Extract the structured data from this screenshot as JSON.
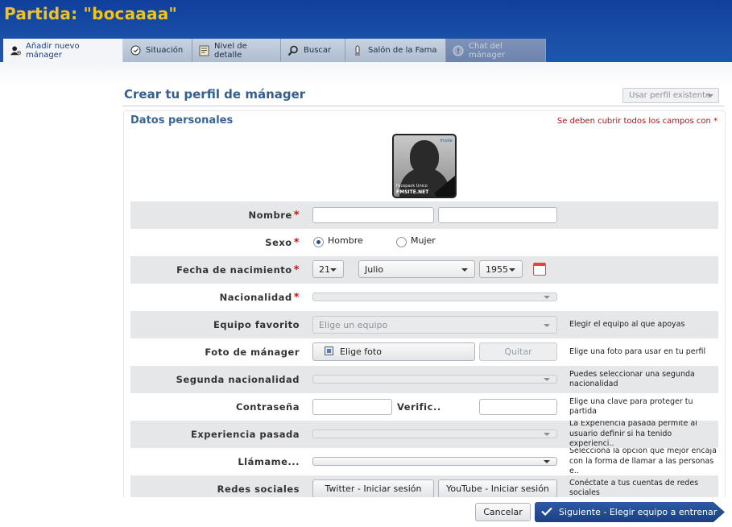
{
  "window": {
    "title": "Partida: \"bocaaaa\""
  },
  "tabs": [
    {
      "label": "Añadir nuevo mánager",
      "icon": "add-manager-icon",
      "active": true
    },
    {
      "label": "Situación",
      "icon": "status-icon"
    },
    {
      "label": "Nivel de detalle",
      "icon": "detail-icon"
    },
    {
      "label": "Buscar",
      "icon": "search-icon"
    },
    {
      "label": "Salón de la Fama",
      "icon": "hall-of-fame-icon"
    },
    {
      "label": "Chat del mánager",
      "icon": "chat-icon",
      "disabled": true
    }
  ],
  "page": {
    "heading": "Crear tu perfil de mánager",
    "existing_profile": "Usar perfil existente"
  },
  "section": {
    "title": "Datos personales",
    "required_note": "Se deben cubrir todos los campos con",
    "required_star": "*"
  },
  "avatar": {
    "caption_small": "Facepack Unico",
    "caption_site": "FMSITE.NET",
    "logo": "fmsite"
  },
  "form": {
    "nombre": {
      "label": "Nombre",
      "first": "",
      "last": ""
    },
    "sexo": {
      "label": "Sexo",
      "opt_male": "Hombre",
      "opt_female": "Mujer",
      "selected": "Hombre"
    },
    "fecha": {
      "label": "Fecha de nacimiento",
      "day": "21",
      "month": "Julio",
      "year": "1955"
    },
    "nacionalidad": {
      "label": "Nacionalidad",
      "value": ""
    },
    "equipo": {
      "label": "Equipo favorito",
      "placeholder": "Elige un equipo",
      "help": "Elegir el equipo al que apoyas"
    },
    "foto": {
      "label": "Foto de mánager",
      "choose": "Elige foto",
      "remove": "Quitar",
      "help": "Elige una foto para usar en tu perfil"
    },
    "segunda": {
      "label": "Segunda nacionalidad",
      "help": "Puedes seleccionar una segunda nacionalidad"
    },
    "password": {
      "label": "Contraseña",
      "verify_label": "Verific..",
      "help": "Elige una clave para proteger tu partida"
    },
    "experiencia": {
      "label": "Experiencia pasada",
      "help": "La Experiencia pasada permite al usuario definir si ha tenido experienci.."
    },
    "llamame": {
      "label": "Llámame...",
      "help": "Selecciona la opción que mejor encaja con la forma de llamar a las personas e.."
    },
    "redes": {
      "label": "Redes sociales",
      "twitter": "Twitter - Iniciar sesión",
      "youtube": "YouTube - Iniciar sesión",
      "help": "Conéctate a tus cuentas de redes sociales"
    }
  },
  "footer": {
    "cancel": "Cancelar",
    "next": "Siguiente - Elegir equipo a entrenar"
  },
  "colors": {
    "title": "#f2c31b",
    "topbar": "#1a4fa8",
    "required": "#c01818",
    "primary_button": "#1c3f82"
  }
}
